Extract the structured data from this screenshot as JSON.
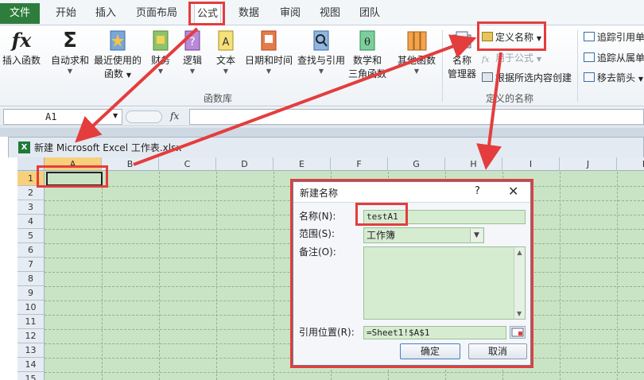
{
  "tabs": {
    "file": "文件",
    "items": [
      "开始",
      "插入",
      "页面布局",
      "公式",
      "数据",
      "审阅",
      "视图",
      "团队"
    ],
    "active": "公式"
  },
  "ribbon": {
    "insert_function": "插入函数",
    "autosum": "自动求和",
    "recent_line1": "最近使用的",
    "recent_line2": "函数",
    "financial": "财务",
    "logical": "逻辑",
    "text": "文本",
    "datetime": "日期和时间",
    "lookup": "查找与引用",
    "math_line1": "数学和",
    "math_line2": "三角函数",
    "other": "其他函数",
    "group_library": "函数库",
    "name_manager_line1": "名称",
    "name_manager_line2": "管理器",
    "define_name": "定义名称",
    "use_in_formula": "用于公式",
    "create_from_selection": "根据所选内容创建",
    "group_defined_names": "定义的名称",
    "trace_precedents": "追踪引用单",
    "trace_dependents": "追踪从属单",
    "remove_arrows": "移去箭头",
    "fx_glyph": "fx",
    "sigma_glyph": "Σ"
  },
  "formula_bar": {
    "cell_ref": "A1",
    "fx": "fx"
  },
  "workbook": {
    "title": "新建 Microsoft Excel 工作表.xlsx"
  },
  "grid": {
    "columns": [
      "A",
      "B",
      "C",
      "D",
      "E",
      "F",
      "G",
      "H",
      "I",
      "J",
      "K"
    ],
    "rows": [
      "1",
      "2",
      "3",
      "4",
      "5",
      "6",
      "7",
      "8",
      "9",
      "10",
      "11",
      "12",
      "13",
      "14",
      "15"
    ],
    "selected_column": "A",
    "selected_row": "1"
  },
  "dialog": {
    "title": "新建名称",
    "help": "?",
    "close": "✕",
    "name_label": "名称(N):",
    "name_value": "testA1",
    "scope_label": "范围(S):",
    "scope_value": "工作簿",
    "comment_label": "备注(O):",
    "refers_label": "引用位置(R):",
    "refers_value": "=Sheet1!$A$1",
    "ok": "确定",
    "cancel": "取消"
  },
  "colors": {
    "file_tab": "#2e7d3c",
    "annotation": "#e43d3d",
    "grid_bg": "#c9e4c4"
  }
}
